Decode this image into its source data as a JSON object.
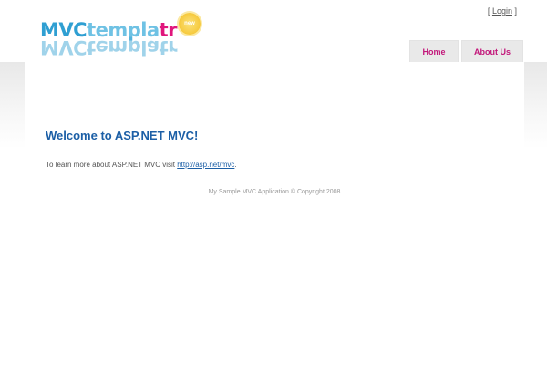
{
  "header": {
    "logo": {
      "part_mvc": "MVC",
      "part_templa": "templa",
      "part_tr": "tr",
      "reflection": "MVCtemplatr",
      "badge": "new"
    },
    "login": {
      "open_bracket": "[",
      "link_label": "Login",
      "close_bracket": "]"
    },
    "nav": {
      "home_label": "Home",
      "about_label": "About Us"
    }
  },
  "main": {
    "welcome_heading": "Welcome to ASP.NET MVC!",
    "intro_text": "To learn more about ASP.NET MVC visit ",
    "intro_link": "http://asp.net/mvc",
    "intro_end": "."
  },
  "footer": {
    "text": "My Sample MVC Application © Copyright 2008"
  },
  "colors": {
    "nav_text": "#c2177a",
    "heading": "#1c5fa6",
    "logo_blue": "#2f9fd2",
    "logo_pink": "#e0167c"
  }
}
